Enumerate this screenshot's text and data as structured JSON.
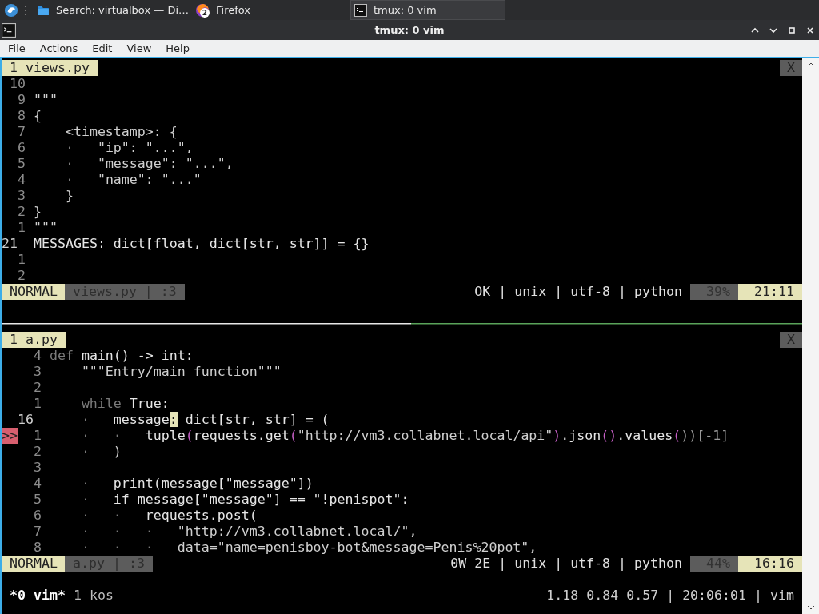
{
  "taskbar": {
    "tasks": [
      {
        "title": "Search: virtualbox — Di…",
        "kind": "folder",
        "selected": false
      },
      {
        "title": "Firefox",
        "kind": "browser",
        "badge": "2",
        "selected": false
      },
      {
        "title": "tmux: 0 vim",
        "kind": "terminal",
        "selected": true
      }
    ]
  },
  "window": {
    "title": "tmux: 0 vim"
  },
  "menu": [
    "File",
    "Actions",
    "Edit",
    "View",
    "Help"
  ],
  "panes": [
    {
      "tab": {
        "label": "1 views.py",
        "close": "X"
      },
      "lines": [
        {
          "num": "10",
          "current": false
        },
        {
          "num": "9",
          "current": false,
          "segments": [
            {
              "text": "\"\"\"",
              "kind": "text"
            }
          ]
        },
        {
          "num": "8",
          "current": false,
          "segments": [
            {
              "text": "{",
              "kind": "text"
            }
          ]
        },
        {
          "num": "7",
          "current": false,
          "segments": [
            {
              "text": "    <timestamp>: {",
              "kind": "text"
            }
          ]
        },
        {
          "num": "6",
          "current": false,
          "segments": [
            {
              "text": "    ·   ",
              "kind": "dim"
            },
            {
              "text": "\"ip\": \"...\",",
              "kind": "text"
            }
          ]
        },
        {
          "num": "5",
          "current": false,
          "segments": [
            {
              "text": "    ·   ",
              "kind": "dim"
            },
            {
              "text": "\"message\": \"...\",",
              "kind": "text"
            }
          ]
        },
        {
          "num": "4",
          "current": false,
          "segments": [
            {
              "text": "    ·   ",
              "kind": "dim"
            },
            {
              "text": "\"name\": \"...\"",
              "kind": "text"
            }
          ]
        },
        {
          "num": "3",
          "current": false,
          "segments": [
            {
              "text": "    }",
              "kind": "text"
            }
          ]
        },
        {
          "num": "2",
          "current": false,
          "segments": [
            {
              "text": "}",
              "kind": "text"
            }
          ]
        },
        {
          "num": "1",
          "current": false,
          "segments": [
            {
              "text": "\"\"\"",
              "kind": "text"
            }
          ]
        },
        {
          "num": "21",
          "current": true,
          "segments": [
            {
              "text": "MESSAGES: dict[float, dict[str, str]] = {}",
              "kind": "bright"
            }
          ]
        },
        {
          "num": "1",
          "current": false
        },
        {
          "num": "2",
          "current": false
        }
      ],
      "status": {
        "mode": "NORMAL",
        "file": "views.py | :3",
        "right": "OK | unix | utf-8 | python",
        "percent": "39%",
        "position": "21:11"
      }
    },
    {
      "tab": {
        "label": "1 a.py",
        "close": "X"
      },
      "lines": [
        {
          "num": "4",
          "current": false,
          "segments": [
            {
              "text": "def ",
              "kind": "dim"
            },
            {
              "text": "main() -> int:",
              "kind": "bright"
            }
          ]
        },
        {
          "num": "3",
          "current": false,
          "segments": [
            {
              "text": "    \"\"\"Entry/main function\"\"\"",
              "kind": "text"
            }
          ]
        },
        {
          "num": "2",
          "current": false
        },
        {
          "num": "1",
          "current": false,
          "segments": [
            {
              "text": "    while ",
              "kind": "dim"
            },
            {
              "text": "True:",
              "kind": "bright"
            }
          ]
        },
        {
          "num": "16",
          "current": true,
          "segments": [
            {
              "text": "    ·   ",
              "kind": "dim"
            },
            {
              "text": "message",
              "kind": "bright"
            },
            {
              "text": ":",
              "kind": "cursor"
            },
            {
              "text": " dict[str, str] = (",
              "kind": "bright"
            }
          ]
        },
        {
          "num": "1",
          "current": false,
          "sign": ">>",
          "segments": [
            {
              "text": "    ·   ·   ",
              "kind": "dim"
            },
            {
              "text": "tuple",
              "kind": "bright"
            },
            {
              "text": "(",
              "kind": "paren"
            },
            {
              "text": "requests.get",
              "kind": "bright"
            },
            {
              "text": "(",
              "kind": "paren"
            },
            {
              "text": "\"http://vm3.collabnet.local/api\"",
              "kind": "text"
            },
            {
              "text": ")",
              "kind": "paren"
            },
            {
              "text": ".json",
              "kind": "bright"
            },
            {
              "text": "()",
              "kind": "paren"
            },
            {
              "text": ".values",
              "kind": "bright"
            },
            {
              "text": "(",
              "kind": "paren"
            },
            {
              "text": "))[-1]",
              "kind": "underline"
            }
          ]
        },
        {
          "num": "2",
          "current": false,
          "segments": [
            {
              "text": "    ·   ",
              "kind": "dim"
            },
            {
              "text": ")",
              "kind": "text"
            }
          ]
        },
        {
          "num": "3",
          "current": false
        },
        {
          "num": "4",
          "current": false,
          "segments": [
            {
              "text": "    ·   ",
              "kind": "dim"
            },
            {
              "text": "print(message[\"message\"])",
              "kind": "bright"
            }
          ]
        },
        {
          "num": "5",
          "current": false,
          "segments": [
            {
              "text": "    ·   ",
              "kind": "dim"
            },
            {
              "text": "if message[\"message\"] == \"!penispot\":",
              "kind": "bright"
            }
          ]
        },
        {
          "num": "6",
          "current": false,
          "segments": [
            {
              "text": "    ·   ·   ",
              "kind": "dim"
            },
            {
              "text": "requests.post(",
              "kind": "bright"
            }
          ]
        },
        {
          "num": "7",
          "current": false,
          "segments": [
            {
              "text": "    ·   ·   ·   ",
              "kind": "dim"
            },
            {
              "text": "\"http://vm3.collabnet.local/\",",
              "kind": "text"
            }
          ]
        },
        {
          "num": "8",
          "current": false,
          "segments": [
            {
              "text": "    ·   ·   ·   ",
              "kind": "dim"
            },
            {
              "text": "data=\"name=penisboy-bot&message=Penis%20pot\",",
              "kind": "text"
            }
          ]
        }
      ],
      "status": {
        "mode": "NORMAL",
        "file": "a.py | :3",
        "right": "0W 2E | unix | utf-8 | python",
        "percent": "44%",
        "position": "16:16"
      }
    }
  ],
  "tmux_status": {
    "windows": [
      {
        "label": "*0 vim*",
        "selected": true
      },
      {
        "label": "1 kos",
        "selected": false
      }
    ],
    "right": "1.18 0.84 0.57 | 20:06:01 | vim"
  }
}
